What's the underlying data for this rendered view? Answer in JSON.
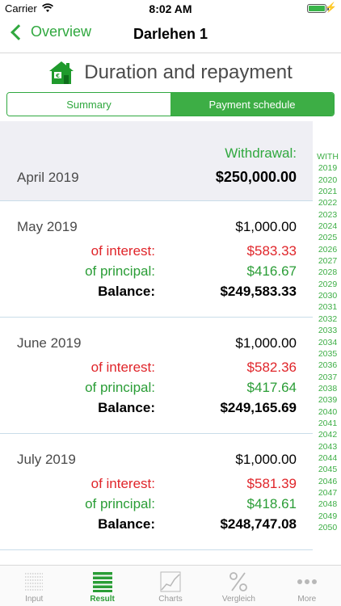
{
  "status": {
    "carrier": "Carrier",
    "time": "8:02 AM"
  },
  "nav": {
    "back_label": "Overview",
    "title": "Darlehen 1"
  },
  "heading": {
    "title": "Duration and repayment"
  },
  "segments": {
    "summary": "Summary",
    "schedule": "Payment schedule",
    "selected": "Payment schedule"
  },
  "first_entry": {
    "type_label": "Withdrawal:",
    "month": "April 2019",
    "amount": "$250,000.00"
  },
  "labels": {
    "interest": "of interest:",
    "principal": "of principal:",
    "balance": "Balance:"
  },
  "entries": [
    {
      "month": "May 2019",
      "payment": "$1,000.00",
      "interest": "$583.33",
      "principal": "$416.67",
      "balance": "$249,583.33"
    },
    {
      "month": "June 2019",
      "payment": "$1,000.00",
      "interest": "$582.36",
      "principal": "$417.64",
      "balance": "$249,165.69"
    },
    {
      "month": "July 2019",
      "payment": "$1,000.00",
      "interest": "$581.39",
      "principal": "$418.61",
      "balance": "$248,747.08"
    }
  ],
  "index": [
    "WITH",
    "2019",
    "2020",
    "2021",
    "2022",
    "2023",
    "2024",
    "2025",
    "2026",
    "2027",
    "2028",
    "2029",
    "2030",
    "2031",
    "2032",
    "2033",
    "2034",
    "2035",
    "2036",
    "2037",
    "2038",
    "2039",
    "2040",
    "2041",
    "2042",
    "2043",
    "2044",
    "2045",
    "2046",
    "2047",
    "2048",
    "2049",
    "2050"
  ],
  "tabs": [
    {
      "label": "Input",
      "icon": "input-icon"
    },
    {
      "label": "Result",
      "icon": "result-icon"
    },
    {
      "label": "Charts",
      "icon": "charts-icon"
    },
    {
      "label": "Vergleich",
      "icon": "percent-icon"
    },
    {
      "label": "More",
      "icon": "more-icon"
    }
  ],
  "active_tab": "Result",
  "colors": {
    "accent": "#3dae45",
    "interest": "#e0252a",
    "principal": "#2a9d36"
  }
}
